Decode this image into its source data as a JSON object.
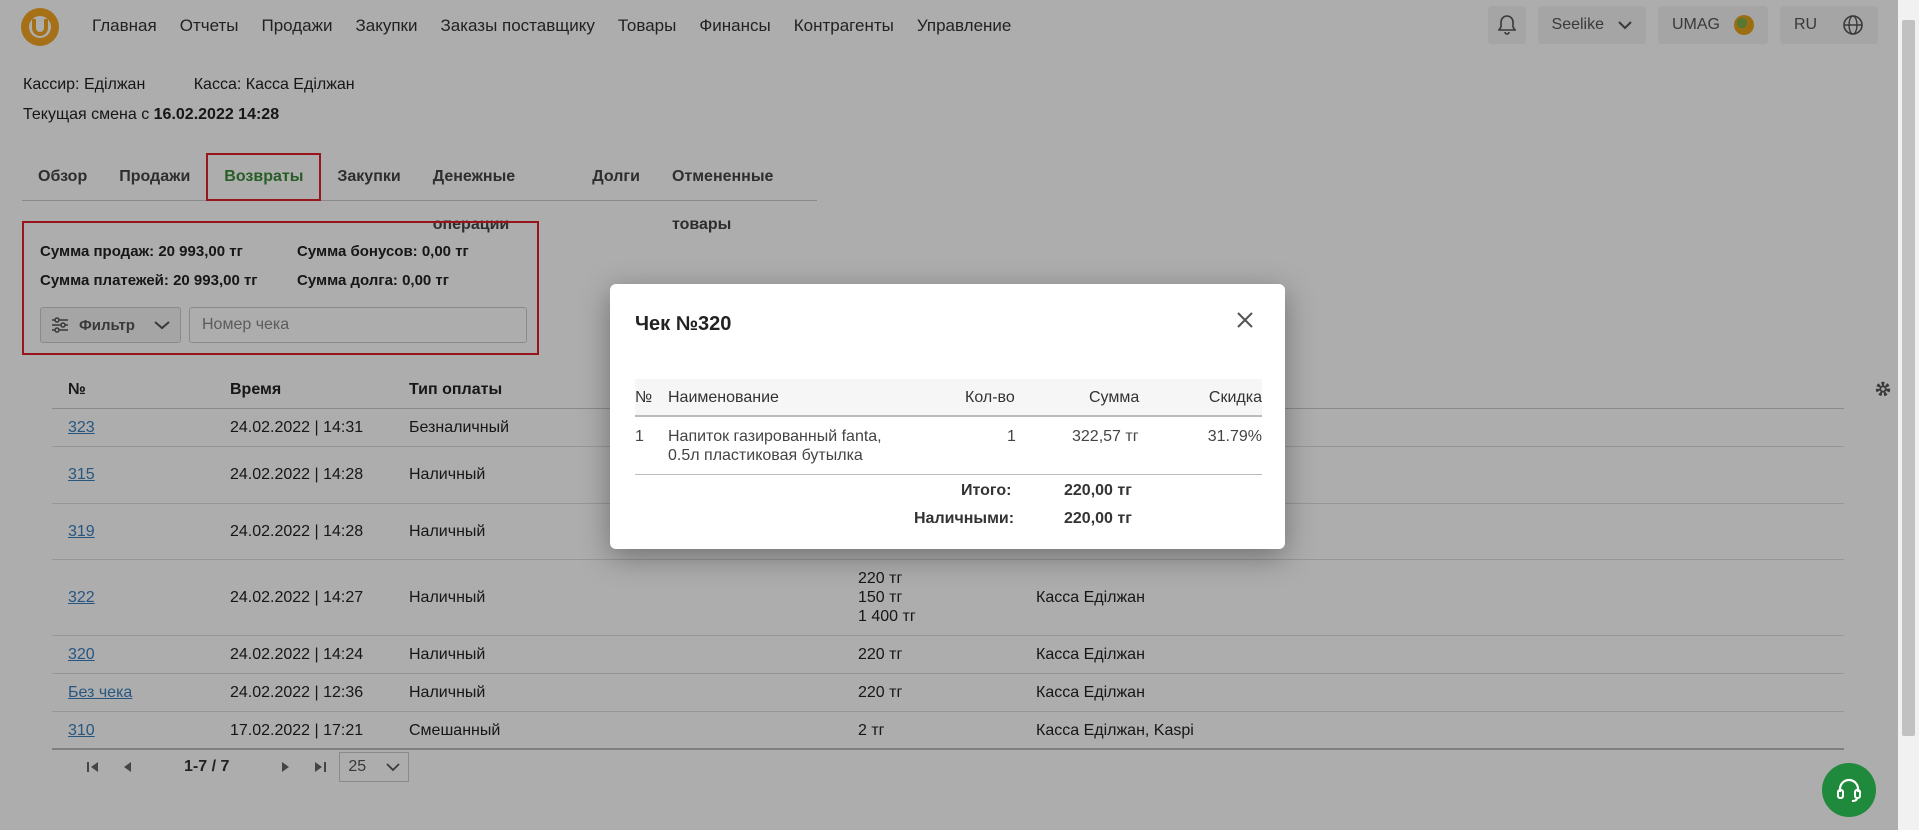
{
  "nav": {
    "items": [
      "Главная",
      "Отчеты",
      "Продажи",
      "Закупки",
      "Заказы поставщику",
      "Товары",
      "Финансы",
      "Контрагенты",
      "Управление"
    ],
    "store": "Seelike",
    "account": "UMAG",
    "lang": "RU"
  },
  "info": {
    "cashier": "Кассир: Еділжан",
    "kassa": "Касса: Касса Еділжан",
    "shift_prefix": "Текущая смена с ",
    "shift_date": "16.02.2022 14:28"
  },
  "tabs": [
    "Обзор",
    "Продажи",
    "Возвраты",
    "Закупки",
    "Денежные операции",
    "Долги",
    "Отмененные товары"
  ],
  "active_tab": "Возвраты",
  "summary": {
    "sales": "Сумма продаж: 20 993,00 тг",
    "bonus": "Сумма бонусов: 0,00 тг",
    "payments": "Сумма платежей: 20 993,00 тг",
    "debt": "Сумма долга: 0,00 тг",
    "filter_label": "Фильтр",
    "check_placeholder": "Номер чека"
  },
  "table": {
    "headers": {
      "num": "№",
      "time": "Время",
      "pay": "Тип оплаты"
    },
    "rows": [
      {
        "num": "323",
        "time": "24.02.2022 | 14:31",
        "pay": "Безналичный",
        "sum": "",
        "kassa": ""
      },
      {
        "num": "315",
        "time": "24.02.2022 | 14:28",
        "pay": "Наличный",
        "sum": "",
        "kassa": ""
      },
      {
        "num": "319",
        "time": "24.02.2022 | 14:28",
        "pay": "Наличный",
        "sum": "",
        "kassa": ""
      },
      {
        "num": "322",
        "time": "24.02.2022 | 14:27",
        "pay": "Наличный",
        "sum1": "220 тг",
        "sum2": "150 тг",
        "sum3": "1 400 тг",
        "kassa": "Касса Еділжан"
      },
      {
        "num": "320",
        "time": "24.02.2022 | 14:24",
        "pay": "Наличный",
        "sum": "220 тг",
        "kassa": "Касса Еділжан"
      },
      {
        "num": "Без чека",
        "time": "24.02.2022 | 12:36",
        "pay": "Наличный",
        "sum": "220 тг",
        "kassa": "Касса Еділжан"
      },
      {
        "num": "310",
        "time": "17.02.2022 | 17:21",
        "pay": "Смешанный",
        "sum": "2 тг",
        "kassa": "Касса Еділжан, Kaspi"
      }
    ]
  },
  "pager": {
    "range": "1-7 / 7",
    "page_size": "25"
  },
  "modal": {
    "title": "Чек №320",
    "headers": {
      "num": "№",
      "name": "Наименование",
      "qty": "Кол-во",
      "sum": "Сумма",
      "discount": "Скидка"
    },
    "item": {
      "num": "1",
      "name1": "Напиток газированный fanta,",
      "name2": "0.5л пластиковая бутылка",
      "qty": "1",
      "sum": "322,57 тг",
      "discount": "31.79%"
    },
    "total_label": "Итого:",
    "total_value": "220,00 тг",
    "cash_label": "Наличными:",
    "cash_value": "220,00 тг"
  }
}
